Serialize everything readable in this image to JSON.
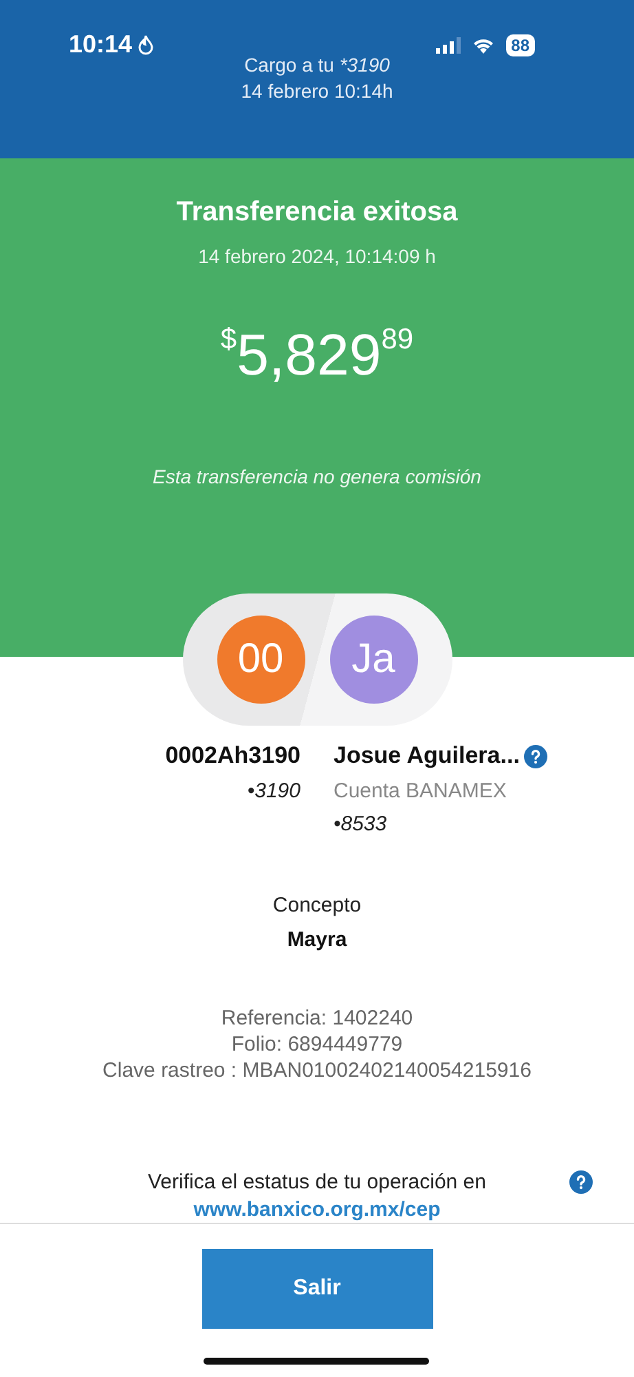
{
  "status_bar": {
    "time": "10:14",
    "battery": "88"
  },
  "header": {
    "charge": "Cargo a tu",
    "account": "*3190",
    "date": "14 febrero 10:14h"
  },
  "result": {
    "title": "Transferencia exitosa",
    "datetime": "14 febrero 2024, 10:14:09 h",
    "amount": {
      "currency": "$",
      "integer": "5,829",
      "cents": "89"
    },
    "note": "Esta transferencia no genera comisión"
  },
  "parties": [
    {
      "initials": "00",
      "color": "#f07a2c",
      "name": "0002Ah3190",
      "lines": [
        {
          "text": "•3190",
          "kind": "account"
        }
      ],
      "help": false
    },
    {
      "initials": "Ja",
      "color": "#a08ee0",
      "name": "Josue Aguilera...",
      "lines": [
        {
          "text": "Cuenta BANAMEX",
          "kind": "bank"
        },
        {
          "text": "•8533",
          "kind": "account"
        }
      ],
      "help": true
    }
  ],
  "concept": {
    "label": "Concepto",
    "value": "Mayra"
  },
  "details": [
    "Referencia: 1402240",
    "Folio: 6894449779",
    "Clave rastreo : MBAN01002402140054215916"
  ],
  "verify": {
    "text": "Verifica el estatus de tu operación en",
    "link": "www.banxico.org.mx/cep"
  },
  "buttons": [
    {
      "label": "Salir"
    }
  ]
}
